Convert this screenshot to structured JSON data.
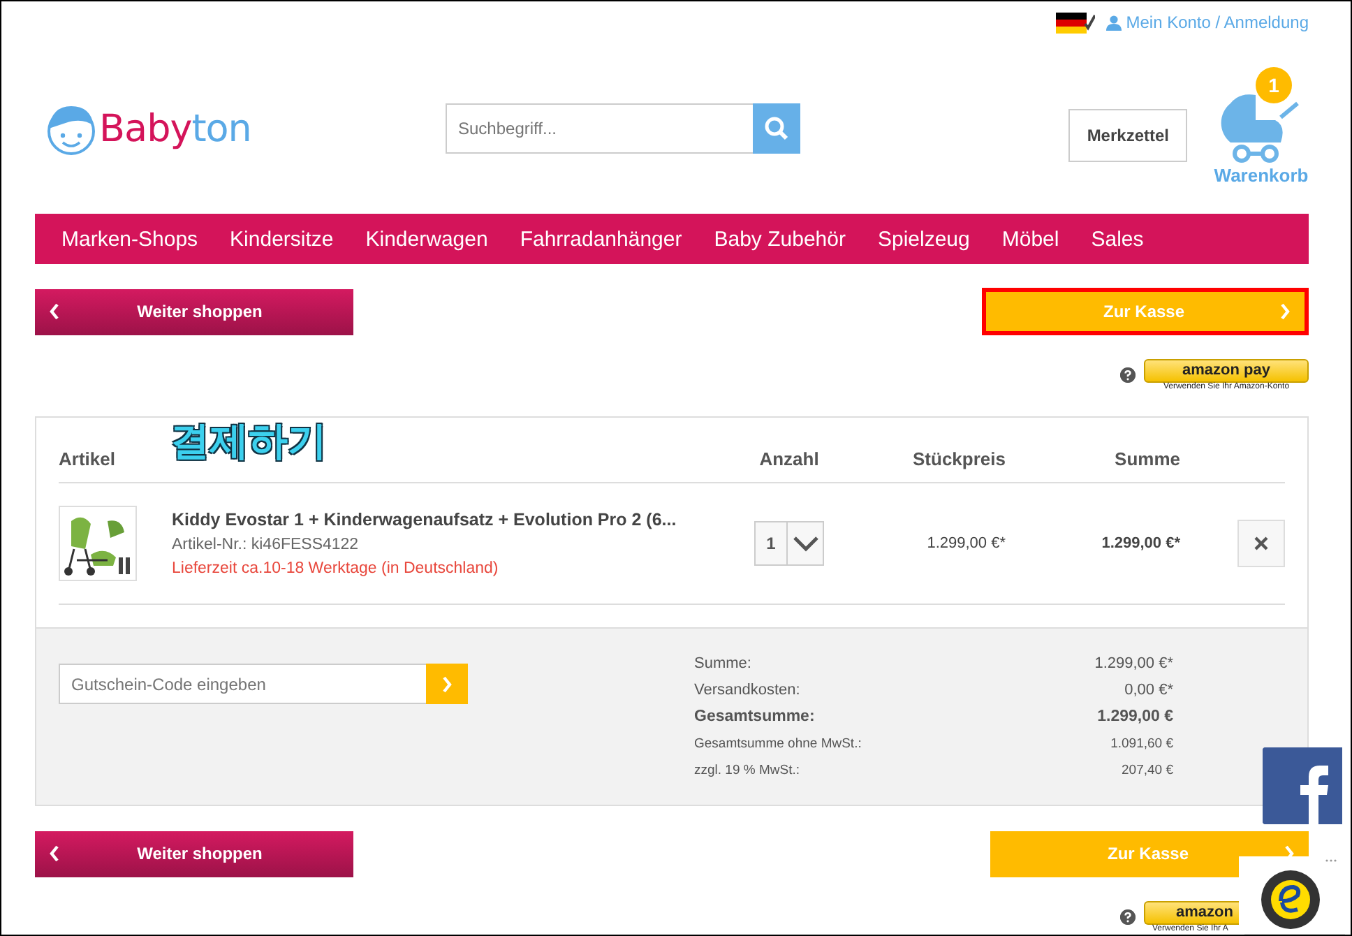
{
  "top_bar": {
    "account_link": "Mein Konto / Anmeldung"
  },
  "logo": {
    "text_1": "Baby",
    "text_2": "ton"
  },
  "search": {
    "placeholder": "Suchbegriff..."
  },
  "wishlist_button": "Merkzettel",
  "cart": {
    "badge": "1",
    "label": "Warenkorb"
  },
  "nav": [
    "Marken-Shops",
    "Kindersitze",
    "Kinderwagen",
    "Fahrradanhänger",
    "Baby Zubehör",
    "Spielzeug",
    "Möbel",
    "Sales"
  ],
  "actions": {
    "back": "Weiter shoppen",
    "checkout": "Zur Kasse",
    "checkout_highlighted": true
  },
  "amazon_pay": {
    "logo": "amazon pay",
    "caption": "Verwenden Sie Ihr Amazon-Konto"
  },
  "annotation": "결제하기",
  "cart_table": {
    "columns": [
      "Artikel",
      "Anzahl",
      "Stückpreis",
      "Summe"
    ],
    "items": [
      {
        "name": "Kiddy Evostar 1 + Kinderwagenaufsatz + Evolution Pro 2 (6...",
        "sku": "Artikel-Nr.: ki46FESS4122",
        "delivery": "Lieferzeit ca.10-18 Werktage (in Deutschland)",
        "quantity": "1",
        "unit_price": "1.299,00 €*",
        "total": "1.299,00 €*"
      }
    ]
  },
  "voucher": {
    "placeholder": "Gutschein-Code eingeben"
  },
  "summary": [
    {
      "label": "Summe:",
      "value": "1.299,00 €*",
      "kind": "normal"
    },
    {
      "label": "Versandkosten:",
      "value": "0,00 €*",
      "kind": "normal"
    },
    {
      "label": "Gesamtsumme:",
      "value": "1.299,00 €",
      "kind": "bold"
    },
    {
      "label": "Gesamtsumme ohne MwSt.:",
      "value": "1.091,60 €",
      "kind": "small"
    },
    {
      "label": "zzgl. 19 % MwSt.:",
      "value": "207,40 €",
      "kind": "small"
    }
  ],
  "bottom_actions": {
    "back": "Weiter shoppen",
    "checkout": "Zur Kasse",
    "checkout_highlighted": false
  },
  "bottom_amazon_pay": {
    "logo": "amazon",
    "caption": "Verwenden Sie Ihr A"
  }
}
